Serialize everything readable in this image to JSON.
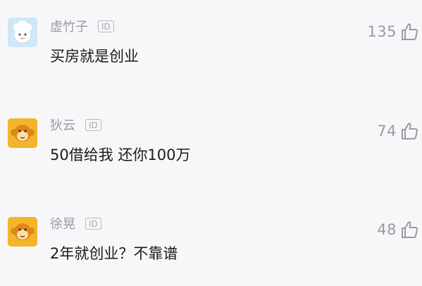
{
  "comments": [
    {
      "username": "虚竹子",
      "badge": "ID",
      "content": "买房就是创业",
      "likes": "135",
      "avatar_icon": "sheep-avatar-icon",
      "avatar_bg": "#cfe7f7"
    },
    {
      "username": "狄云",
      "badge": "ID",
      "content": "50借给我 还你100万",
      "likes": "74",
      "avatar_icon": "monkey-avatar-icon",
      "avatar_bg": "#f3b62a"
    },
    {
      "username": "徐晃",
      "badge": "ID",
      "content": "2年就创业？不靠谱",
      "likes": "48",
      "avatar_icon": "monkey-avatar-icon",
      "avatar_bg": "#f3b62a"
    }
  ],
  "icons": {
    "like": "thumbs-up-icon",
    "badge": "id-badge-icon"
  }
}
